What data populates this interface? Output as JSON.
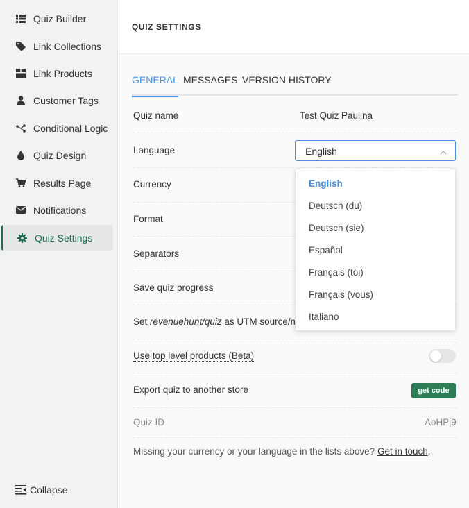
{
  "sidebar": {
    "items": [
      {
        "label": "Quiz Builder",
        "icon": "list-icon"
      },
      {
        "label": "Link Collections",
        "icon": "tag-icon"
      },
      {
        "label": "Link Products",
        "icon": "box-icon"
      },
      {
        "label": "Customer Tags",
        "icon": "user-icon"
      },
      {
        "label": "Conditional Logic",
        "icon": "branch-icon"
      },
      {
        "label": "Quiz Design",
        "icon": "drop-icon"
      },
      {
        "label": "Results Page",
        "icon": "cart-icon"
      },
      {
        "label": "Notifications",
        "icon": "envelope-icon"
      },
      {
        "label": "Quiz Settings",
        "icon": "gear-icon",
        "active": true
      }
    ],
    "collapse_label": "Collapse"
  },
  "header": {
    "title": "QUIZ SETTINGS"
  },
  "tabs": [
    {
      "label": "GENERAL",
      "active": true
    },
    {
      "label": "MESSAGES"
    },
    {
      "label": "VERSION HISTORY"
    }
  ],
  "settings": {
    "quiz_name_label": "Quiz name",
    "quiz_name_value": "Test Quiz Paulina",
    "language_label": "Language",
    "language_value": "English",
    "currency_label": "Currency",
    "format_label": "Format",
    "separators_label": "Separators",
    "save_progress_label": "Save quiz progress",
    "utm_label_prefix": "Set ",
    "utm_label_em": "revenuehunt/quiz",
    "utm_label_suffix": " as UTM source/me",
    "top_level_label": "Use top level products (Beta)",
    "top_level_enabled": false,
    "export_label": "Export quiz to another store",
    "get_code_label": "get code",
    "quiz_id_label": "Quiz ID",
    "quiz_id_value": "AoHPj9"
  },
  "language_options": [
    "English",
    "Deutsch (du)",
    "Deutsch (sie)",
    "Español",
    "Français (toi)",
    "Français (vous)",
    "Italiano"
  ],
  "footer": {
    "note_text": "Missing your currency or your language in the lists above? ",
    "link_text": "Get in touch",
    "trailing": "."
  },
  "colors": {
    "accent": "#4a90e2",
    "active_nav": "#1d6d4f",
    "button": "#2e7d57"
  }
}
